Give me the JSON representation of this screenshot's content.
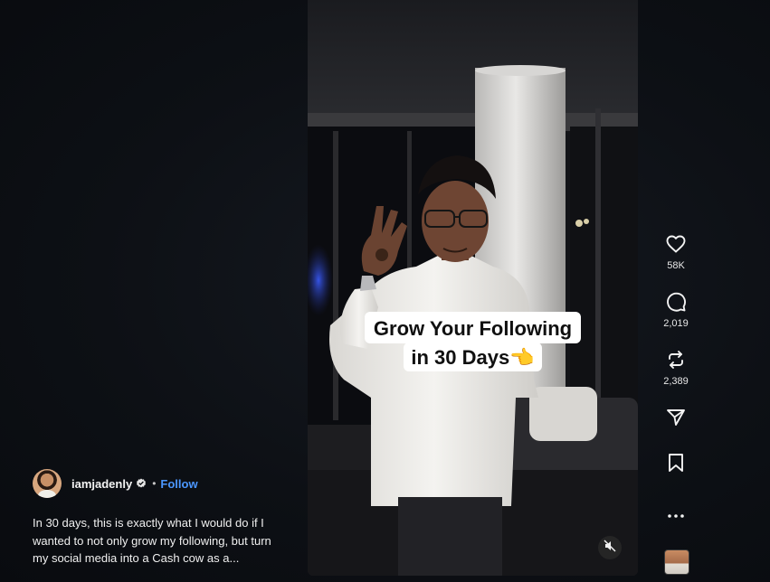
{
  "post": {
    "username": "iamjadenly",
    "separator": "•",
    "follow_label": "Follow",
    "caption": "In 30 days, this is exactly what I would do if I wanted to not only grow my following, but turn my social media into a Cash cow as a..."
  },
  "video": {
    "overlay_line1": "Grow Your Following",
    "overlay_line2": "in 30 Days👈",
    "audio_state": "muted"
  },
  "actions": {
    "likes": "58K",
    "comments": "2,019",
    "reposts": "2,389"
  },
  "icons": {
    "like": "heart-icon",
    "comment": "comment-icon",
    "repost": "repost-icon",
    "share": "send-icon",
    "save": "bookmark-icon",
    "more": "more-icon",
    "mute": "speaker-muted-icon",
    "verified": "verified-badge-icon"
  },
  "colors": {
    "accent": "#4b97ff",
    "background": "#0b0d11",
    "text": "#f5f5f5"
  }
}
